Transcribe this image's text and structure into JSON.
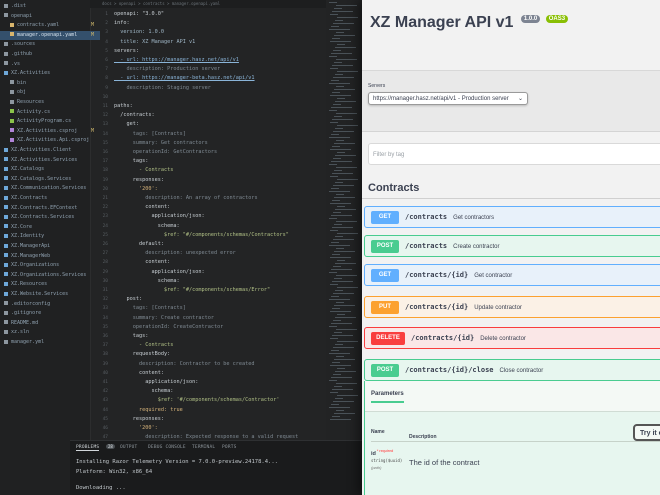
{
  "explorer": {
    "items": [
      {
        "label": ".dist",
        "state": "",
        "color": "#8d97a0"
      },
      {
        "label": "openapi",
        "state": "",
        "color": "#8d97a0"
      },
      {
        "label": "contracts.yaml",
        "state": "M",
        "color": "#d8b56d"
      },
      {
        "label": "manager.openapi.yaml",
        "state": "M",
        "color": "#d8b56d"
      },
      {
        "label": ".sources",
        "state": "",
        "color": "#8d97a0"
      },
      {
        "label": ".github",
        "state": "",
        "color": "#8d97a0"
      },
      {
        "label": ".vs",
        "state": "",
        "color": "#8d97a0"
      },
      {
        "label": "XZ.Activities",
        "state": "",
        "color": "#6ea7d8"
      },
      {
        "label": "bin",
        "state": "",
        "color": "#8d97a0"
      },
      {
        "label": "obj",
        "state": "",
        "color": "#8d97a0"
      },
      {
        "label": "Resources",
        "state": "",
        "color": "#8d97a0"
      },
      {
        "label": "Activity.cs",
        "state": "",
        "color": "#8bc34a"
      },
      {
        "label": "ActivityProgram.cs",
        "state": "",
        "color": "#8bc34a"
      },
      {
        "label": "XZ.Activities.csproj",
        "state": "M",
        "color": "#b084d8"
      },
      {
        "label": "XZ.Activities.Api.csproj",
        "state": "",
        "color": "#b084d8"
      },
      {
        "label": "XZ.Activities.Client",
        "state": "",
        "color": "#6ea7d8"
      },
      {
        "label": "XZ.Activities.Services",
        "state": "",
        "color": "#6ea7d8"
      },
      {
        "label": "XZ.Catalogs",
        "state": "",
        "color": "#6ea7d8"
      },
      {
        "label": "XZ.Catalogs.Services",
        "state": "",
        "color": "#6ea7d8"
      },
      {
        "label": "XZ.Communication.Services",
        "state": "",
        "color": "#6ea7d8"
      },
      {
        "label": "XZ.Contracts",
        "state": "",
        "color": "#6ea7d8"
      },
      {
        "label": "XZ.Contracts.EFContext",
        "state": "",
        "color": "#6ea7d8"
      },
      {
        "label": "XZ.Contracts.Services",
        "state": "",
        "color": "#6ea7d8"
      },
      {
        "label": "XZ.Core",
        "state": "",
        "color": "#6ea7d8"
      },
      {
        "label": "XZ.Identity",
        "state": "",
        "color": "#6ea7d8"
      },
      {
        "label": "XZ.ManagerApi",
        "state": "",
        "color": "#6ea7d8"
      },
      {
        "label": "XZ.ManagerWeb",
        "state": "",
        "color": "#6ea7d8"
      },
      {
        "label": "XZ.Organizations",
        "state": "",
        "color": "#6ea7d8"
      },
      {
        "label": "XZ.Organizations.Services",
        "state": "",
        "color": "#6ea7d8"
      },
      {
        "label": "XZ.Resources",
        "state": "",
        "color": "#6ea7d8"
      },
      {
        "label": "XZ.Website.Services",
        "state": "",
        "color": "#6ea7d8"
      },
      {
        "label": ".editorconfig",
        "state": "",
        "color": "#8d97a0"
      },
      {
        "label": ".gitignore",
        "state": "",
        "color": "#8d97a0"
      },
      {
        "label": "README.md",
        "state": "",
        "color": "#8d97a0"
      },
      {
        "label": "xz.sln",
        "state": "",
        "color": "#8d97a0"
      },
      {
        "label": "manager.yml",
        "state": "",
        "color": "#8d97a0"
      }
    ]
  },
  "editor": {
    "breadcrumb": "docs > openapi > contracts > manager.openapi.yaml",
    "lines": [
      {
        "n": "1",
        "t": "openapi: \"3.0.0\"",
        "cls": "k"
      },
      {
        "n": "2",
        "t": "info:",
        "cls": "k"
      },
      {
        "n": "3",
        "t": "  version: 1.0.0",
        "cls": "v"
      },
      {
        "n": "4",
        "t": "  title: XZ Manager API v1",
        "cls": "v"
      },
      {
        "n": "5",
        "t": "servers:",
        "cls": "k"
      },
      {
        "n": "6",
        "t": "  - url: https://manager.hasz.net/api/v1",
        "cls": "u"
      },
      {
        "n": "7",
        "t": "    description: Production server",
        "cls": "c"
      },
      {
        "n": "8",
        "t": "  - url: https://manager-beta.hasz.net/api/v1",
        "cls": "u"
      },
      {
        "n": "9",
        "t": "    description: Staging server",
        "cls": "c"
      },
      {
        "n": "10",
        "t": "",
        "cls": "k"
      },
      {
        "n": "11",
        "t": "paths:",
        "cls": "k"
      },
      {
        "n": "12",
        "t": "  /contracts:",
        "cls": "k"
      },
      {
        "n": "13",
        "t": "    get:",
        "cls": "k"
      },
      {
        "n": "14",
        "t": "      tags: [Contracts]",
        "cls": "c"
      },
      {
        "n": "15",
        "t": "      summary: Get contractors",
        "cls": "c"
      },
      {
        "n": "16",
        "t": "      operationId: GetContractors",
        "cls": "c"
      },
      {
        "n": "17",
        "t": "      tags:",
        "cls": "k"
      },
      {
        "n": "18",
        "t": "        - Contracts",
        "cls": "s"
      },
      {
        "n": "19",
        "t": "      responses:",
        "cls": "k"
      },
      {
        "n": "20",
        "t": "        '200':",
        "cls": "n"
      },
      {
        "n": "21",
        "t": "          description: An array of contractors",
        "cls": "c"
      },
      {
        "n": "22",
        "t": "          content:",
        "cls": "k"
      },
      {
        "n": "23",
        "t": "            application/json:",
        "cls": "k"
      },
      {
        "n": "24",
        "t": "              schema:",
        "cls": "k"
      },
      {
        "n": "25",
        "t": "                $ref: \"#/components/schemas/Contractors\"",
        "cls": "s"
      },
      {
        "n": "26",
        "t": "        default:",
        "cls": "k"
      },
      {
        "n": "27",
        "t": "          description: unexpected error",
        "cls": "c"
      },
      {
        "n": "28",
        "t": "          content:",
        "cls": "k"
      },
      {
        "n": "29",
        "t": "            application/json:",
        "cls": "k"
      },
      {
        "n": "30",
        "t": "              schema:",
        "cls": "k"
      },
      {
        "n": "31",
        "t": "                $ref: \"#/components/schemas/Error\"",
        "cls": "s"
      },
      {
        "n": "32",
        "t": "    post:",
        "cls": "k"
      },
      {
        "n": "33",
        "t": "      tags: [Contracts]",
        "cls": "c"
      },
      {
        "n": "34",
        "t": "      summary: Create contractor",
        "cls": "c"
      },
      {
        "n": "35",
        "t": "      operationId: CreateContractor",
        "cls": "c"
      },
      {
        "n": "36",
        "t": "      tags:",
        "cls": "k"
      },
      {
        "n": "37",
        "t": "        - Contracts",
        "cls": "s"
      },
      {
        "n": "38",
        "t": "      requestBody:",
        "cls": "k"
      },
      {
        "n": "39",
        "t": "        description: Contractor to be created",
        "cls": "c"
      },
      {
        "n": "40",
        "t": "        content:",
        "cls": "k"
      },
      {
        "n": "41",
        "t": "          application/json:",
        "cls": "k"
      },
      {
        "n": "42",
        "t": "            schema:",
        "cls": "k"
      },
      {
        "n": "43",
        "t": "              $ref: '#/components/schemas/Contractor'",
        "cls": "s"
      },
      {
        "n": "44",
        "t": "        required: true",
        "cls": "n"
      },
      {
        "n": "45",
        "t": "      responses:",
        "cls": "k"
      },
      {
        "n": "46",
        "t": "        '200':",
        "cls": "n"
      },
      {
        "n": "47",
        "t": "          description: Expected response to a valid request",
        "cls": "c"
      }
    ]
  },
  "panel": {
    "tabs": [
      "PROBLEMS",
      "OUTPUT",
      "DEBUG CONSOLE",
      "TERMINAL",
      "PORTS"
    ],
    "problems_count": "28",
    "terminal_lines": [
      "Installing Razor Telemetry Version = 7.0.0-preview.24178.4...",
      "Platform: Win32, x86_64",
      "Downloading ..."
    ]
  },
  "swagger": {
    "title": "XZ Manager API v1",
    "version_badge": "1.0.0",
    "oas_badge": "OAS3",
    "servers_label": "Servers",
    "server_selected": "https://manager.hasz.net/api/v1 - Production server",
    "filter_placeholder": "Filter by tag",
    "section_title": "Contracts",
    "operations": [
      {
        "method": "GET",
        "path": "/contracts",
        "summary": "Get contractors",
        "kind": "get"
      },
      {
        "method": "POST",
        "path": "/contracts",
        "summary": "Create contractor",
        "kind": "post"
      },
      {
        "method": "GET",
        "path": "/contracts/{id}",
        "summary": "Get contractor",
        "kind": "get"
      },
      {
        "method": "PUT",
        "path": "/contracts/{id}",
        "summary": "Update contractor",
        "kind": "put"
      },
      {
        "method": "DELETE",
        "path": "/contracts/{id}",
        "summary": "Delete contractor",
        "kind": "del"
      },
      {
        "method": "POST",
        "path": "/contracts/{id}/close",
        "summary": "Close contractor",
        "kind": "post"
      }
    ],
    "params_tab": "Parameters",
    "col_name": "Name",
    "col_description": "Description",
    "try_button": "Try it out",
    "param_name": "id",
    "param_required": "* required",
    "param_type": "string($uuid)",
    "param_in": "(path)",
    "param_desc": "The id of the contract"
  },
  "colors": {
    "get": "#61affe",
    "post": "#49cc90",
    "put": "#fca130",
    "delete": "#f93e3e"
  }
}
